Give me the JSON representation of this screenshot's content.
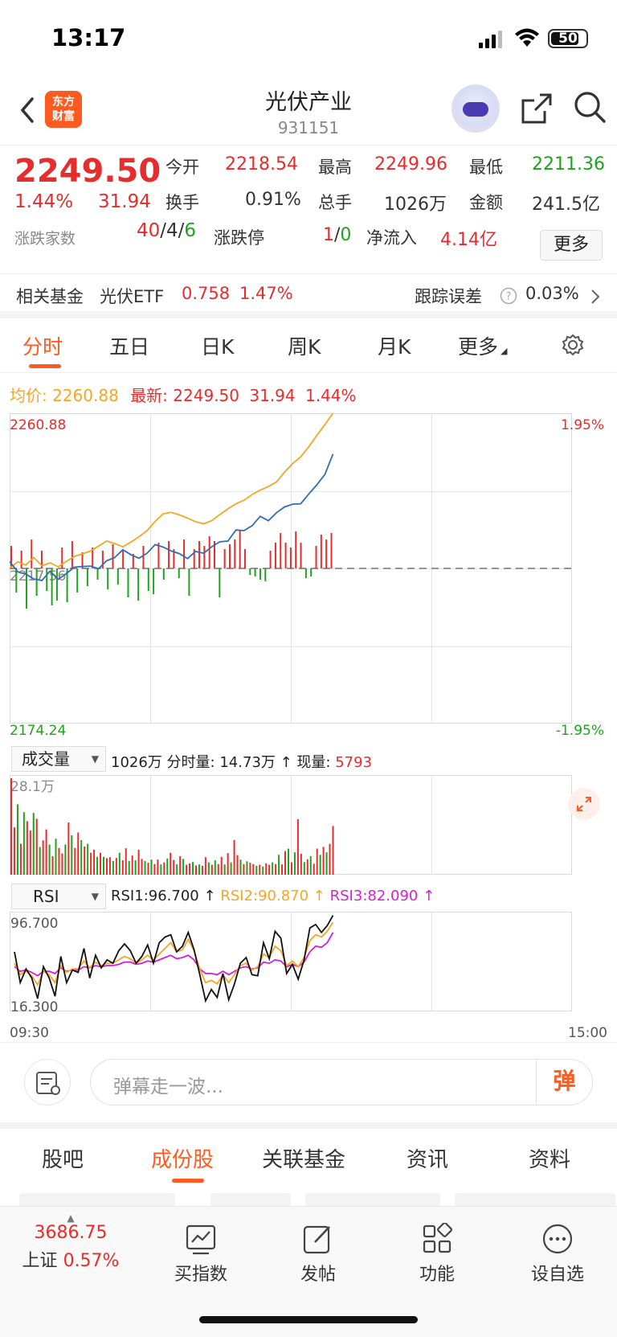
{
  "status_bar": {
    "time": "13:17",
    "battery": "50"
  },
  "nav": {
    "logo_line1": "东方",
    "logo_line2": "财富",
    "title": "光伏产业",
    "code": "931151"
  },
  "quote": {
    "price": "2249.50",
    "change_pct": "1.44%",
    "change_abs": "31.94",
    "open_label": "今开",
    "open": "2218.54",
    "high_label": "最高",
    "high": "2249.96",
    "low_label": "最低",
    "low": "2211.36",
    "turnover_label": "换手",
    "turnover": "0.91%",
    "volume_label": "总手",
    "volume": "1026万",
    "amount_label": "金额",
    "amount": "241.5亿",
    "adv_dec_label": "涨跌家数",
    "adv": "40",
    "flat": "4",
    "dec": "6",
    "sep": "/",
    "limit_label": "涨跌停",
    "limit_up": "1",
    "limit_down": "0",
    "netflow_label": "净流入",
    "netflow": "4.14亿",
    "more_button": "更多"
  },
  "fund": {
    "label": "相关基金",
    "name": "光伏ETF",
    "price": "0.758",
    "pct": "1.47%",
    "tracking_label": "跟踪误差",
    "tracking_value": "0.03%"
  },
  "tabs": [
    "分时",
    "五日",
    "日K",
    "周K",
    "月K",
    "更多"
  ],
  "chart_header": {
    "avg_label": "均价:",
    "avg_value": "2260.88",
    "latest_label": "最新:",
    "latest_value": "2249.50",
    "latest_change": "31.94",
    "latest_pct": "1.44%"
  },
  "colors": {
    "up": "#e62c2c",
    "down": "#1fa31f",
    "avg": "#f5a623",
    "price": "#2f6db6",
    "accent": "#ff5a1f",
    "rsi3": "#d41fd4"
  },
  "volume_header": {
    "select": "成交量",
    "total": "1026万",
    "period_label": "分时量:",
    "period_value": "14.73万",
    "now_label": "现量:",
    "now_value": "5793"
  },
  "rsi_header": {
    "select": "RSI",
    "rsi1": "RSI1:96.700",
    "rsi2": "RSI2:90.870",
    "rsi3": "RSI3:82.090"
  },
  "chart_data": [
    {
      "type": "line",
      "title": "",
      "y_labels_left": {
        "top": "2260.88",
        "mid": "2217.56",
        "bottom": "2174.24"
      },
      "y_labels_right": {
        "top": "1.95%",
        "bottom": "-1.95%"
      },
      "ylim": [
        2174.24,
        2260.88
      ],
      "x_range": [
        "09:30",
        "15:00"
      ],
      "series": [
        {
          "name": "均价",
          "values": [
            2217.6,
            2219.4,
            2218.5,
            2220.6,
            2218.3,
            2219.1,
            2218.0,
            2219.5,
            2220.9,
            2221.6,
            2222.4,
            2223.8,
            2225.2,
            2224.5,
            2223.6,
            2224.9,
            2226.4,
            2228.1,
            2230.7,
            2232.8,
            2233.2,
            2232.5,
            2231.6,
            2230.6,
            2230.0,
            2230.9,
            2232.6,
            2234.2,
            2235.6,
            2236.6,
            2238.2,
            2239.4,
            2240.4,
            2241.7,
            2244.4,
            2246.8,
            2248.7,
            2251.5,
            2254.7,
            2257.7,
            2260.9
          ]
        },
        {
          "name": "最新",
          "values": [
            2219.5,
            2216.6,
            2216.0,
            2214.6,
            2214.2,
            2216.8,
            2214.5,
            2216.1,
            2217.9,
            2218.1,
            2218.2,
            2217.5,
            2219.7,
            2220.6,
            2222.8,
            2221.4,
            2220.4,
            2221.8,
            2224.2,
            2223.5,
            2222.4,
            2221.7,
            2220.3,
            2222.3,
            2221.8,
            2223.6,
            2225.0,
            2225.2,
            2228.3,
            2228.1,
            2229.5,
            2232.1,
            2230.9,
            2233.1,
            2234.7,
            2235.5,
            2235.6,
            2238.3,
            2240.9,
            2243.8,
            2249.5
          ]
        }
      ],
      "breadth_bars": [
        2.8,
        -3.0,
        2.2,
        -5.0,
        3.6,
        -3.4,
        2.2,
        -2.8,
        -4.6,
        -4.0,
        2.6,
        -4.2,
        3.4,
        -3.0,
        2.0,
        -2.2,
        2.6,
        -1.4,
        2.2,
        -2.6,
        3.0,
        -2.0,
        2.2,
        -3.6,
        1.8,
        -4.0,
        2.8,
        -2.8,
        -3.2,
        3.2,
        -1.4,
        3.4,
        2.4,
        -1.2,
        3.6,
        -3.4,
        2.4,
        3.4,
        2.8,
        4.0,
        3.4,
        -3.6,
        2.4,
        3.0,
        3.6,
        4.8,
        2.4,
        -0.8,
        -1.0,
        -1.4,
        -1.6,
        2.2,
        3.2,
        4.4,
        3.2,
        2.6,
        4.6,
        3.2,
        -1.2,
        -1.0,
        2.8,
        4.2,
        3.6,
        4.4
      ]
    },
    {
      "type": "bar",
      "title": "成交量",
      "y_max_label": "28.1万",
      "ylim": [
        0,
        28.1
      ],
      "values": [
        28.1,
        13.8,
        20.5,
        9.0,
        18.2,
        15.6,
        12.9,
        18.0,
        16.3,
        8.1,
        10.0,
        13.2,
        8.8,
        5.4,
        10.5,
        7.8,
        6.2,
        8.8,
        15.2,
        11.5,
        7.8,
        12.3,
        10.1,
        8.2,
        9.0,
        6.4,
        7.3,
        5.2,
        6.4,
        5.2,
        4.8,
        5.1,
        4.0,
        4.9,
        6.4,
        4.2,
        7.7,
        4.0,
        5.6,
        4.2,
        7.3,
        4.6,
        4.0,
        3.5,
        4.4,
        3.1,
        4.4,
        3.0,
        3.6,
        4.7,
        6.4,
        4.3,
        3.0,
        5.4,
        4.6,
        2.9,
        3.3,
        3.7,
        2.7,
        3.0,
        2.6,
        5.1,
        3.6,
        2.9,
        4.2,
        3.1,
        5.2,
        3.0,
        6.3,
        3.6,
        10.1,
        5.7,
        4.4,
        3.1,
        3.9,
        3.5,
        3.1,
        2.6,
        2.9,
        2.4,
        3.3,
        2.9,
        3.6,
        3.1,
        5.8,
        3.0,
        6.9,
        7.6,
        3.6,
        6.5,
        16.2,
        6.1,
        3.7,
        4.5,
        5.4,
        3.2,
        7.6,
        5.8,
        8.1,
        6.5,
        9.0,
        14.2
      ]
    },
    {
      "type": "line",
      "title": "RSI",
      "y_labels": {
        "top": "96.700",
        "bottom": "16.300"
      },
      "ylim": [
        16.3,
        96.7
      ],
      "series": [
        {
          "name": "RSI1",
          "values": [
            65,
            38,
            50,
            42,
            24,
            52,
            42,
            26,
            61,
            38,
            49,
            47,
            68,
            42,
            62,
            51,
            58,
            55,
            66,
            72,
            66,
            55,
            61,
            71,
            55,
            73,
            78,
            80,
            65,
            70,
            82,
            67,
            45,
            22,
            32,
            25,
            46,
            23,
            37,
            55,
            60,
            45,
            44,
            73,
            59,
            83,
            77,
            46,
            54,
            41,
            58,
            86,
            89,
            82,
            88,
            97
          ]
        },
        {
          "name": "RSI2",
          "values": [
            55,
            45,
            48,
            44,
            36,
            48,
            45,
            38,
            53,
            47,
            50,
            50,
            57,
            51,
            56,
            53,
            55,
            55,
            58,
            61,
            59,
            55,
            58,
            62,
            58,
            63,
            68,
            73,
            65,
            67,
            76,
            66,
            50,
            38,
            40,
            37,
            45,
            38,
            45,
            53,
            55,
            49,
            52,
            63,
            60,
            70,
            66,
            53,
            57,
            52,
            60,
            75,
            80,
            78,
            83,
            91
          ]
        },
        {
          "name": "RSI3",
          "values": [
            52,
            48,
            49,
            47,
            44,
            48,
            48,
            46,
            51,
            48,
            49,
            49,
            52,
            51,
            53,
            52,
            53,
            53,
            54,
            56,
            56,
            54,
            55,
            57,
            56,
            58,
            60,
            62,
            59,
            60,
            62,
            58,
            50,
            46,
            46,
            45,
            48,
            45,
            48,
            51,
            52,
            50,
            51,
            56,
            55,
            58,
            57,
            52,
            54,
            52,
            56,
            65,
            70,
            69,
            73,
            82
          ]
        }
      ]
    }
  ],
  "comment": {
    "placeholder": "弹幕走一波...",
    "dan": "弹"
  },
  "bottom_tabs": [
    "股吧",
    "成份股",
    "关联基金",
    "资讯",
    "资料"
  ],
  "toolbar": {
    "index_value": "3686.75",
    "index_name": "上证",
    "index_pct": "0.57%",
    "buy": "买指数",
    "post": "发帖",
    "func": "功能",
    "watch": "设自选"
  }
}
